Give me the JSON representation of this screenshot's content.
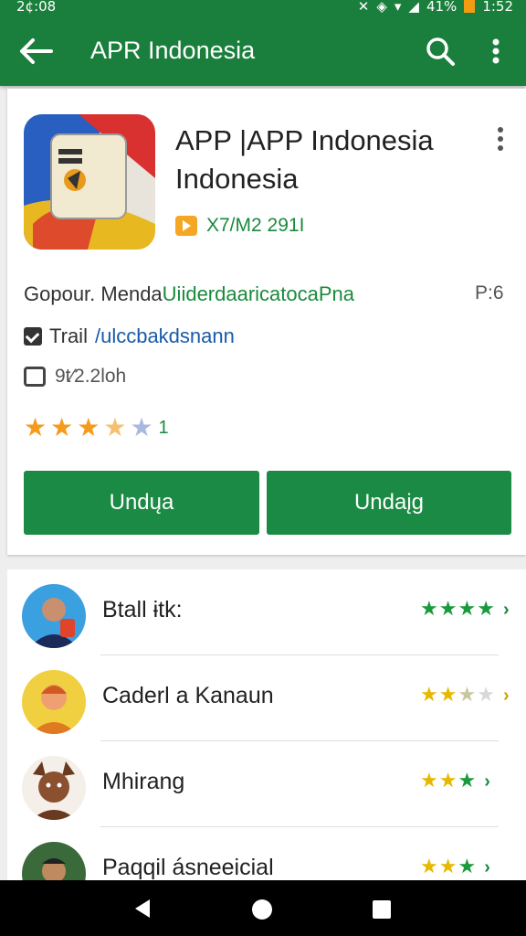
{
  "status_bar": {
    "time_left": "2¢:08",
    "battery": "41%",
    "time_right": "1:52"
  },
  "toolbar": {
    "title": "APR Indonesia",
    "bg": "#1a7f3c"
  },
  "app": {
    "name": "APP |APP Indonesia Indonesia",
    "badge_text": "X7/M2 291I",
    "info_prefix": "Gopour. Menda",
    "info_link": "UiiderdaaricatocaPna",
    "info_right": "P:6",
    "trail_label": "Trail",
    "trail_link": "/ulccbakdsnann",
    "downloads": "9t⁄2.2loh",
    "rating_text": "1",
    "rating_stars": 3.5,
    "button_left": "Undųa",
    "button_right": "Undaįg"
  },
  "list": [
    {
      "title": "Btall ɨtk:",
      "stars": 4,
      "star_color": "#1a9a3c",
      "chevron": "›"
    },
    {
      "title": "Caderl a Kanaun",
      "stars": 2.5,
      "star_color": "#e6b800",
      "chevron": "›"
    },
    {
      "title": "Mhirang",
      "stars": 3,
      "star_color": "#e6b800",
      "chevron": "›"
    },
    {
      "title": "Paqqil ásneeicial",
      "stars": 3,
      "star_color": "#e6b800",
      "chevron": "›"
    }
  ],
  "colors": {
    "accent": "#1a8a44",
    "star_orange": "#f59a1b"
  }
}
